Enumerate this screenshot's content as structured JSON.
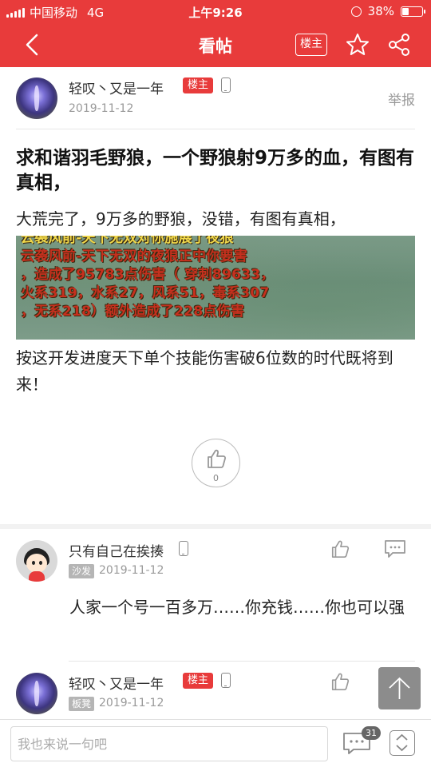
{
  "status_bar": {
    "carrier": "中国移动",
    "network": "4G",
    "time": "上午9:26",
    "battery": "38%",
    "battery_level": 0.38
  },
  "nav": {
    "title": "看帖",
    "owner_only_label": "楼主",
    "icons": [
      "back-arrow-icon",
      "star-icon",
      "share-icon"
    ]
  },
  "post": {
    "author": "轻叹丶又是一年",
    "owner_badge": "楼主",
    "date": "2019-11-12",
    "report": "举报",
    "title": "求和谐羽毛野狼，一个野狼射9万多的血，有图有真相，",
    "paragraph1": "大荒完了，9万多的野狼，没错，有图有真相，",
    "image_lines": [
      "云袭风前-天下无双对你施展了夜狼",
      "云袭风前-天下无双的夜狼正中你要害",
      "，造成了95783点伤害（ 穿刺89633，",
      "火系319，水系27，风系51，毒系307",
      "，无系218）额外造成了228点伤害"
    ],
    "paragraph2": "按这开发进度天下单个技能伤害破6位数的时代既将到来！",
    "like_count": "0"
  },
  "replies": [
    {
      "author": "只有自己在挨揍",
      "floor": "沙发",
      "date": "2019-11-12",
      "text": "人家一个号一百多万……你充钱……你也可以强"
    },
    {
      "author": "轻叹丶又是一年",
      "owner_badge": "楼主",
      "floor": "板凳",
      "date": "2019-11-12"
    }
  ],
  "bottom_bar": {
    "placeholder": "我也来说一句吧",
    "comment_count": "31"
  },
  "colors": {
    "brand_red": "#e83b3b",
    "text_gray": "#999999"
  }
}
